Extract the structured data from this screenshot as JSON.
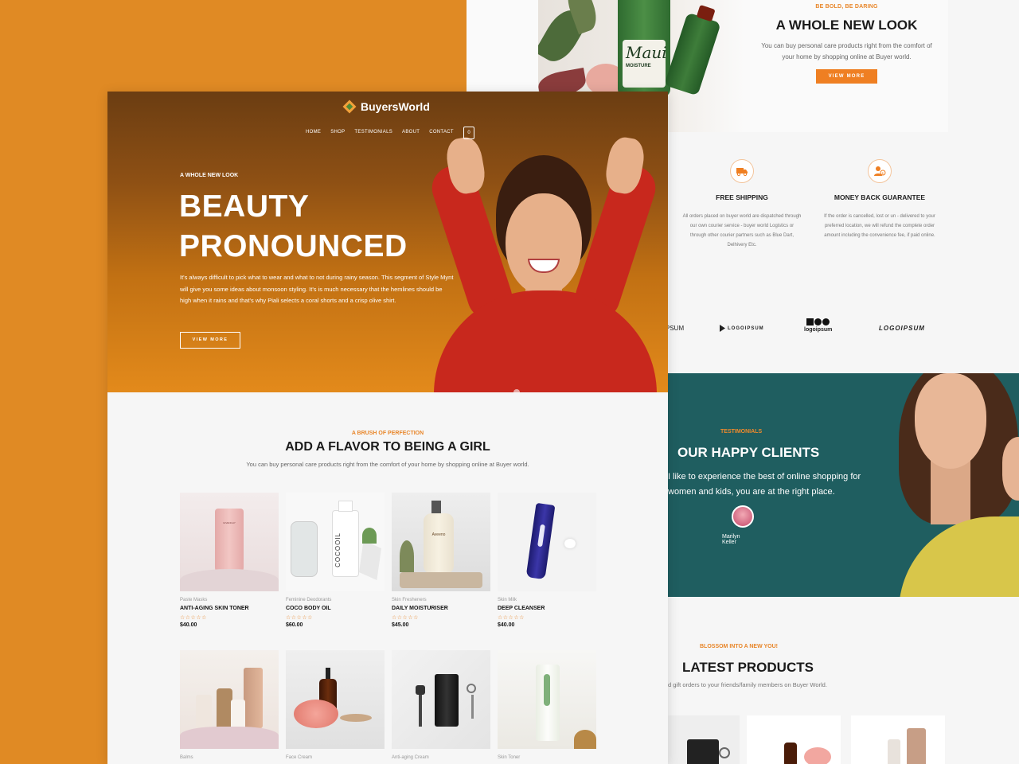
{
  "colors": {
    "accent": "#ef7f22",
    "background": "#e08a24",
    "teal": "#1f5e60"
  },
  "back_page": {
    "hero": {
      "kicker": "BE BOLD, BE DARING",
      "title": "A WHOLE NEW LOOK",
      "description": "You can buy personal care products right from the comfort of your home by shopping online at Buyer world.",
      "button": "VIEW MORE",
      "bottle_brand": "Maui",
      "bottle_sub": "MOISTURE"
    },
    "features": [
      {
        "icon": "truck-icon",
        "title": "FREE SHIPPING",
        "description": "All orders placed on buyer world are dispatched through our own courier service - buyer world Logistics or through other courier partners such as Blue Dart, Delhivery Etc."
      },
      {
        "icon": "money-back-icon",
        "title": "MONEY BACK GUARANTEE",
        "description": "If the order is cancelled, lost or un - delivered to your preferred location, we will refund the complete order amount including the convenience fee, if paid online."
      }
    ],
    "logos": [
      "PSUM",
      "LOGOIPSUM",
      "logoipsum",
      "LOGOIPSUM"
    ],
    "testimonials": {
      "kicker": "TESTIMONIALS",
      "title": "OUR HAPPY CLIENTS",
      "quote": "I like to experience the best of online shopping for women and kids, you are at the right place.",
      "name": "Marilyn Keller"
    },
    "latest": {
      "kicker": "BLOSSOM INTO A NEW YOU!",
      "title": "LATEST PRODUCTS",
      "description": "d gift orders to your friends/family members on Buyer World."
    }
  },
  "front_page": {
    "brand": "BuyersWorld",
    "nav": [
      "HOME",
      "SHOP",
      "TESTIMONIALS",
      "ABOUT",
      "CONTACT"
    ],
    "cart_count": "0",
    "hero": {
      "kicker": "A WHOLE NEW LOOK",
      "title_line1": "BEAUTY",
      "title_line2": "PRONOUNCED",
      "description": "It's always difficult to pick what to wear and what to not during rainy season. This segment of Style Mynt will give you some ideas about monsoon styling. It's is much necessary that the hemlines should be high when it rains and that's why Piali selects a coral shorts and a crisp olive shirt.",
      "button": "VIEW MORE"
    },
    "section": {
      "kicker": "A BRUSH OF PERFECTION",
      "title": "ADD A FLAVOR TO BEING A GIRL",
      "description": "You can buy personal care products right from the comfort of your home by shopping online at Buyer world."
    },
    "products": [
      {
        "category": "Paste Masks",
        "name": "ANTI-AGING SKIN TONER",
        "stars": "☆☆☆☆☆",
        "price": "$40.00",
        "tube_text": "GIVENCHY"
      },
      {
        "category": "Feminine Deodorants",
        "name": "COCO BODY OIL",
        "stars": "☆☆☆☆☆",
        "price": "$60.00",
        "tube_text": "COCOOIL"
      },
      {
        "category": "Skin Fresheners",
        "name": "DAILY MOISTURISER",
        "stars": "☆☆☆☆☆",
        "price": "$45.00",
        "tube_text": "Aveeno"
      },
      {
        "category": "Skin Milk",
        "name": "DEEP CLEANSER",
        "stars": "☆☆☆☆☆",
        "price": "$40.00",
        "tube_text": ""
      },
      {
        "category": "Balms"
      },
      {
        "category": "Face Cream"
      },
      {
        "category": "Anti-aging Cream"
      },
      {
        "category": "Skin Toner"
      }
    ]
  }
}
